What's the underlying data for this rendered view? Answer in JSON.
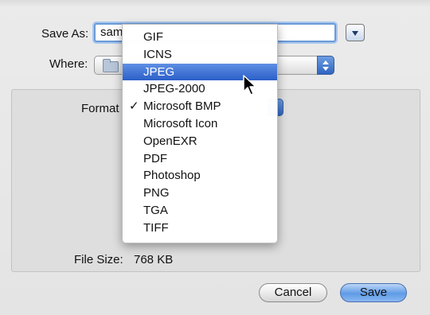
{
  "save_as": {
    "label": "Save As:",
    "value": "sam"
  },
  "where": {
    "label": "Where:"
  },
  "format": {
    "label": "Format",
    "menu": {
      "items": [
        {
          "label": "GIF",
          "checked": false,
          "highlighted": false
        },
        {
          "label": "ICNS",
          "checked": false,
          "highlighted": false
        },
        {
          "label": "JPEG",
          "checked": false,
          "highlighted": true
        },
        {
          "label": "JPEG-2000",
          "checked": false,
          "highlighted": false
        },
        {
          "label": "Microsoft BMP",
          "checked": true,
          "highlighted": false
        },
        {
          "label": "Microsoft Icon",
          "checked": false,
          "highlighted": false
        },
        {
          "label": "OpenEXR",
          "checked": false,
          "highlighted": false
        },
        {
          "label": "PDF",
          "checked": false,
          "highlighted": false
        },
        {
          "label": "Photoshop",
          "checked": false,
          "highlighted": false
        },
        {
          "label": "PNG",
          "checked": false,
          "highlighted": false
        },
        {
          "label": "TGA",
          "checked": false,
          "highlighted": false
        },
        {
          "label": "TIFF",
          "checked": false,
          "highlighted": false
        }
      ],
      "check_glyph": "✓"
    }
  },
  "file_size": {
    "label": "File Size:",
    "value": "768 KB"
  },
  "buttons": {
    "cancel": "Cancel",
    "save": "Save"
  },
  "icons": {
    "expand": "disclosure-triangle-icon",
    "where_folder": "folder-icon",
    "stepper": "popup-stepper-icon",
    "cursor": "mouse-pointer-icon"
  },
  "colors": {
    "highlight": "#3a6fd4",
    "accent_blue": "#5f9be6",
    "focus_ring": "#a9c7ee"
  }
}
